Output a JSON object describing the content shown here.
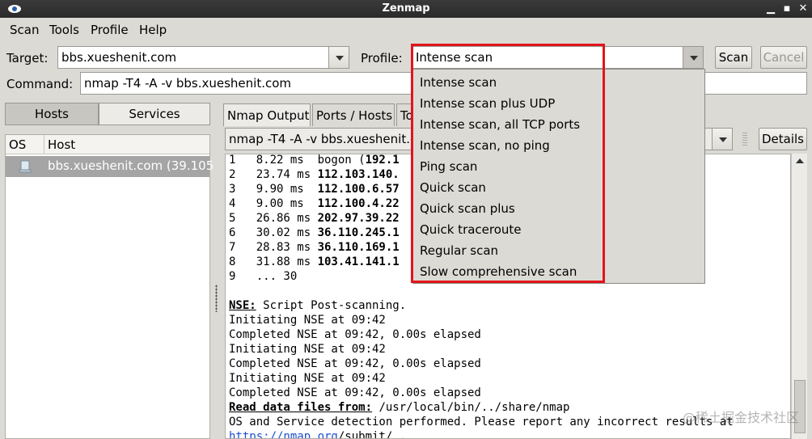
{
  "window": {
    "title": "Zenmap"
  },
  "menu": [
    "Scan",
    "Tools",
    "Profile",
    "Help"
  ],
  "target": {
    "label": "Target:",
    "value": "bbs.xueshenit.com"
  },
  "profile": {
    "label": "Profile:",
    "value": "Intense scan"
  },
  "buttons": {
    "scan": "Scan",
    "cancel": "Cancel",
    "details": "Details"
  },
  "command": {
    "label": "Command:",
    "value": "nmap -T4 -A -v bbs.xueshenit.com"
  },
  "left_tabs": {
    "hosts": "Hosts",
    "services": "Services"
  },
  "host_list": {
    "columns": [
      "OS",
      "Host"
    ],
    "rows": [
      {
        "host": "bbs.xueshenit.com (39.105"
      }
    ]
  },
  "output_tabs": [
    "Nmap Output",
    "Ports / Hosts",
    "To"
  ],
  "output_command": "nmap -T4 -A -v bbs.xueshenit.c",
  "output_lines": [
    {
      "plain": "1   8.22 ms  bogon (",
      "bold": "192.1"
    },
    {
      "plain": "2   23.74 ms ",
      "bold": "112.103.140."
    },
    {
      "plain": "3   9.90 ms  ",
      "bold": "112.100.6.57"
    },
    {
      "plain": "4   9.00 ms  ",
      "bold": "112.100.4.22"
    },
    {
      "plain": "5   26.86 ms ",
      "bold": "202.97.39.22"
    },
    {
      "plain": "6   30.02 ms ",
      "bold": "36.110.245.1"
    },
    {
      "plain": "7   28.83 ms ",
      "bold": "36.110.169.1"
    },
    {
      "plain": "8   31.88 ms ",
      "bold": "103.41.141.1"
    },
    {
      "plain": "9   ... 30",
      "bold": ""
    },
    {
      "plain": "",
      "bold": ""
    },
    {
      "bold_u": "NSE:",
      "plain": " Script Post-scanning."
    },
    {
      "plain": "Initiating NSE at 09:42"
    },
    {
      "plain": "Completed NSE at 09:42, 0.00s elapsed"
    },
    {
      "plain": "Initiating NSE at 09:42"
    },
    {
      "plain": "Completed NSE at 09:42, 0.00s elapsed"
    },
    {
      "plain": "Initiating NSE at 09:42"
    },
    {
      "plain": "Completed NSE at 09:42, 0.00s elapsed"
    },
    {
      "bold_u": "Read data files from:",
      "plain": " /usr/local/bin/../share/nmap"
    },
    {
      "plain": "OS and Service detection performed. Please report any incorrect results at"
    },
    {
      "link": "https://nmap.org",
      "plain": "/submit/ ."
    }
  ],
  "profile_options": [
    "Intense scan",
    "Intense scan plus UDP",
    "Intense scan, all TCP ports",
    "Intense scan, no ping",
    "Ping scan",
    "Quick scan",
    "Quick scan plus",
    "Quick traceroute",
    "Regular scan",
    "Slow comprehensive scan"
  ],
  "watermark": "@稀土掘金技术社区",
  "colors": {
    "highlight_box": "#e2141c",
    "selected_row": "#a5a5a5"
  }
}
